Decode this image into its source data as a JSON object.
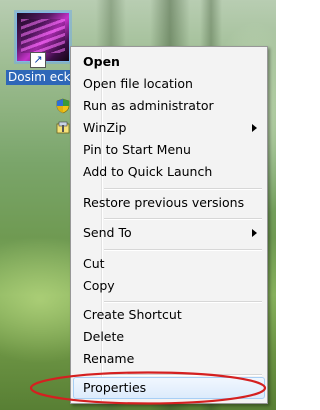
{
  "desktop": {
    "icon": {
      "label": "Dosim eckT",
      "icon_name": "application-shortcut-icon"
    }
  },
  "context_menu": {
    "items": [
      {
        "label": "Open",
        "bold": true,
        "icon": ""
      },
      {
        "label": "Open file location",
        "bold": false,
        "icon": ""
      },
      {
        "label": "Run as administrator",
        "bold": false,
        "icon": "uac-shield-icon"
      },
      {
        "label": "WinZip",
        "bold": false,
        "icon": "winzip-icon",
        "submenu": true
      },
      {
        "label": "Pin to Start Menu",
        "bold": false,
        "icon": ""
      },
      {
        "label": "Add to Quick Launch",
        "bold": false,
        "icon": ""
      },
      {
        "label": "Restore previous versions",
        "bold": false,
        "icon": ""
      },
      {
        "label": "Send To",
        "bold": false,
        "icon": "",
        "submenu": true
      },
      {
        "label": "Cut",
        "bold": false,
        "icon": ""
      },
      {
        "label": "Copy",
        "bold": false,
        "icon": ""
      },
      {
        "label": "Create Shortcut",
        "bold": false,
        "icon": ""
      },
      {
        "label": "Delete",
        "bold": false,
        "icon": ""
      },
      {
        "label": "Rename",
        "bold": false,
        "icon": ""
      },
      {
        "label": "Properties",
        "bold": false,
        "icon": "",
        "highlighted": true
      }
    ]
  },
  "annotation": {
    "shape": "ellipse",
    "color": "#d42020",
    "target": "Properties"
  },
  "colors": {
    "menu_bg": "#f3f3f3",
    "highlight_border": "#a8cff5",
    "selection": "#2e67b8"
  }
}
